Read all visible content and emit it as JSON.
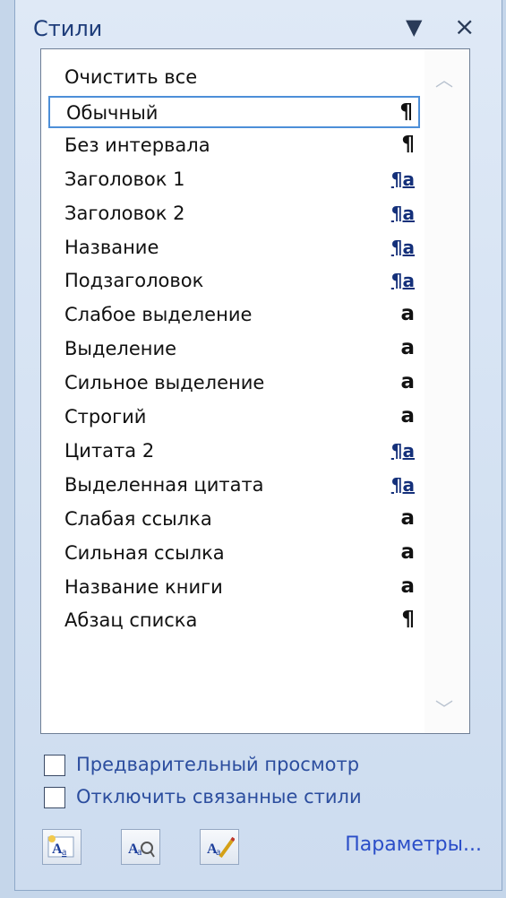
{
  "panel": {
    "title": "Стили",
    "menu_icon": "dropdown-arrow-icon",
    "close_icon": "close-icon",
    "close_glyph": "×",
    "menu_glyph": "▼"
  },
  "styles": [
    {
      "name": "Очистить все",
      "type": "none",
      "glyph": ""
    },
    {
      "name": "Обычный",
      "type": "paragraph",
      "glyph": "¶",
      "selected": true
    },
    {
      "name": "Без интервала",
      "type": "paragraph",
      "glyph": "¶"
    },
    {
      "name": "Заголовок 1",
      "type": "linked",
      "glyph": "¶a"
    },
    {
      "name": "Заголовок 2",
      "type": "linked",
      "glyph": "¶a"
    },
    {
      "name": "Название",
      "type": "linked",
      "glyph": "¶a"
    },
    {
      "name": "Подзаголовок",
      "type": "linked",
      "glyph": "¶a"
    },
    {
      "name": "Слабое выделение",
      "type": "character",
      "glyph": "a"
    },
    {
      "name": "Выделение",
      "type": "character",
      "glyph": "a"
    },
    {
      "name": "Сильное выделение",
      "type": "character",
      "glyph": "a"
    },
    {
      "name": "Строгий",
      "type": "character",
      "glyph": "a"
    },
    {
      "name": "Цитата 2",
      "type": "linked",
      "glyph": "¶a"
    },
    {
      "name": "Выделенная цитата",
      "type": "linked",
      "glyph": "¶a"
    },
    {
      "name": "Слабая ссылка",
      "type": "character",
      "glyph": "a"
    },
    {
      "name": "Сильная ссылка",
      "type": "character",
      "glyph": "a"
    },
    {
      "name": "Название книги",
      "type": "character",
      "glyph": "a"
    },
    {
      "name": "Абзац списка",
      "type": "paragraph",
      "glyph": "¶"
    }
  ],
  "scrollbar": {
    "up_glyph": "︿",
    "down_glyph": "﹀"
  },
  "options": {
    "preview_label": "Предварительный просмотр",
    "preview_checked": false,
    "disable_linked_label": "Отключить связанные стили",
    "disable_linked_checked": false
  },
  "footer": {
    "new_style_icon": "new-style-icon",
    "style_inspector_icon": "style-inspector-icon",
    "manage_styles_icon": "manage-styles-icon",
    "options_link": "Параметры..."
  },
  "colors": {
    "accent": "#2b4ec8",
    "selection_border": "#4d8fd8",
    "title": "#1e3d7a"
  }
}
